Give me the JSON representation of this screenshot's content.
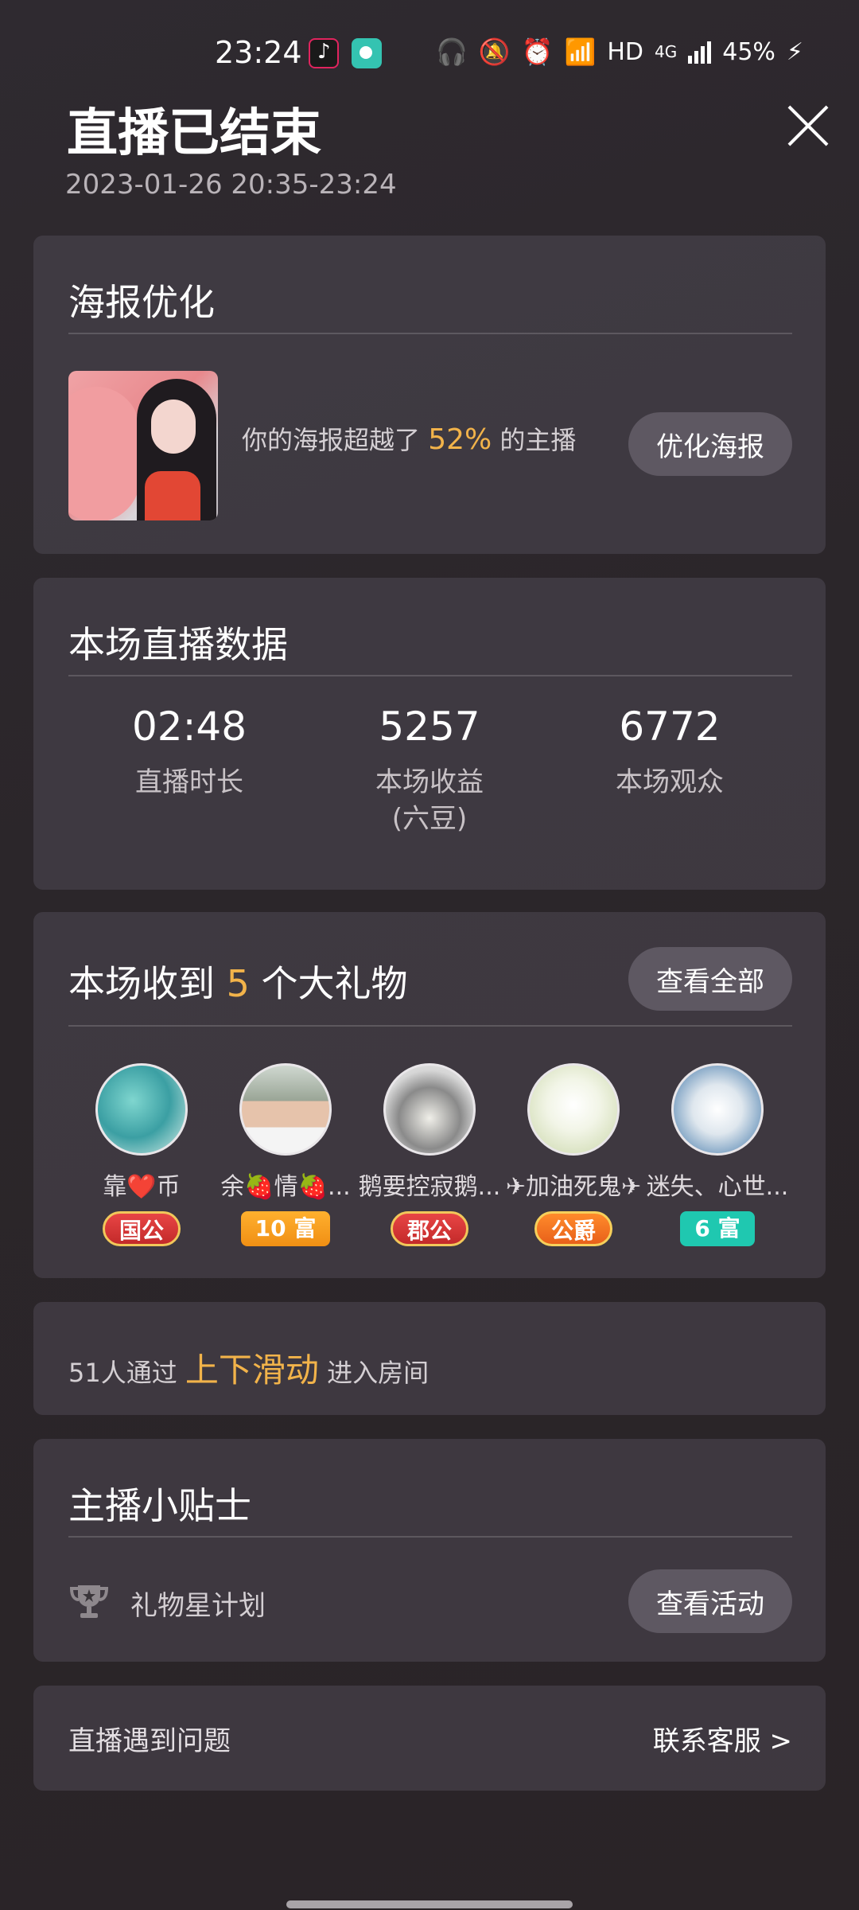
{
  "status_bar": {
    "time": "23:24",
    "network": "HD",
    "cellular": "4G",
    "battery": "45%",
    "icons": [
      "tiktok-app-icon",
      "chat-app-icon",
      "headphones-icon",
      "mute-icon",
      "alarm-icon",
      "wifi-icon",
      "signal-icon",
      "charging-icon"
    ]
  },
  "header": {
    "title": "直播已结束",
    "time_range": "2023-01-26 20:35-23:24"
  },
  "poster": {
    "title": "海报优化",
    "text_before": "你的海报超越了 ",
    "percent": "52%",
    "text_after": " 的主播",
    "button": "优化海报"
  },
  "stats": {
    "title": "本场直播数据",
    "items": [
      {
        "value": "02:48",
        "label": "直播时长"
      },
      {
        "value": "5257",
        "label": "本场收益\n(六豆)"
      },
      {
        "value": "6772",
        "label": "本场观众"
      }
    ]
  },
  "gifts": {
    "title_before": "本场收到 ",
    "count": "5",
    "title_after": " 个大礼物",
    "button": "查看全部",
    "gifters": [
      {
        "name": "靠❤️币",
        "badge": "国公"
      },
      {
        "name": "余🍓情🍓...",
        "badge": "10 富"
      },
      {
        "name": "鹅要控寂鹅...",
        "badge": "郡公"
      },
      {
        "name": "✈加油死鬼✈",
        "badge": "公爵"
      },
      {
        "name": "迷失、心世...",
        "badge": "6 富"
      }
    ]
  },
  "swipe": {
    "text_before": "51人通过 ",
    "highlight": "上下滑动",
    "text_after": " 进入房间"
  },
  "tips": {
    "title": "主播小贴士",
    "item_label": "礼物星计划",
    "button": "查看活动"
  },
  "support": {
    "label": "直播遇到问题",
    "link": "联系客服 >"
  },
  "colors": {
    "accent": "#f2b34a",
    "card_bg": "#4e4854",
    "button_bg": "#5e5862"
  }
}
